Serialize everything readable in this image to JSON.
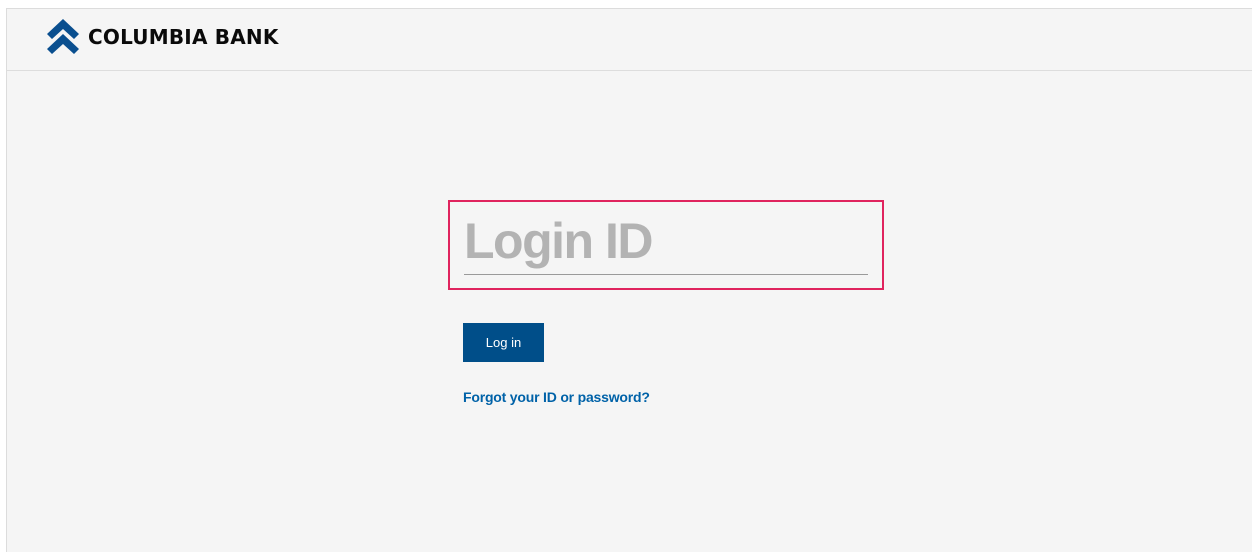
{
  "brand": {
    "name": "COLUMBIA BANK",
    "logo_icon": "chevron-up-logo-icon",
    "logo_color": "#0a4f8f",
    "text_color": "#0a0a0a"
  },
  "login": {
    "id_placeholder": "Login ID",
    "id_value": "",
    "submit_label": "Log in",
    "forgot_label": "Forgot your ID or password?"
  },
  "colors": {
    "background": "#f5f5f5",
    "button": "#004e89",
    "link": "#0062a8",
    "highlight": "#e0245e"
  }
}
